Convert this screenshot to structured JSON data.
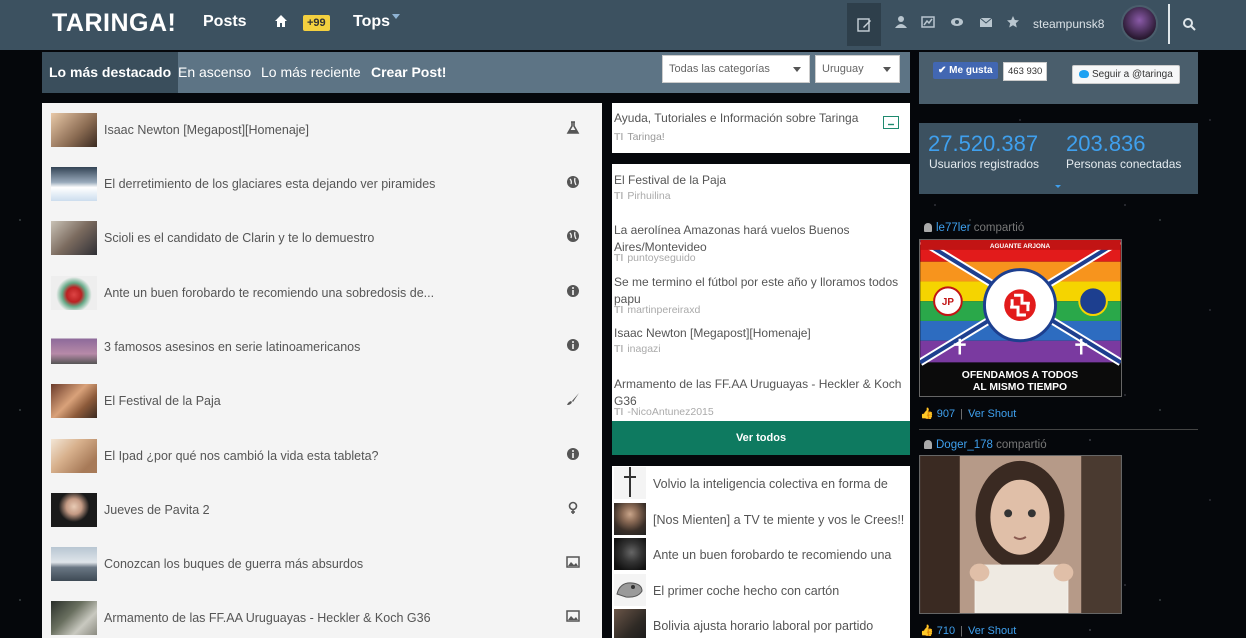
{
  "topbar": {
    "logo": "TARINGA!",
    "posts_label": "Posts",
    "badge": "+99",
    "tops_label": "Tops",
    "username": "steampunsk8"
  },
  "subnav": {
    "items": [
      "Lo más destacado",
      "En ascenso",
      "Lo más reciente",
      "Crear Post!"
    ],
    "category_select": "Todas las categorías",
    "country_select": "Uruguay"
  },
  "posts": [
    {
      "title": "Isaac Newton [Megapost][Homenaje]",
      "icon": "flask-icon"
    },
    {
      "title": "El derretimiento de los glaciares esta dejando ver piramides",
      "icon": "globe-icon"
    },
    {
      "title": "Scioli es el candidato de Clarin y te lo demuestro",
      "icon": "globe-icon"
    },
    {
      "title": "Ante un buen forobardo te recomiendo una sobredosis de...",
      "icon": "info-icon"
    },
    {
      "title": "3 famosos asesinos en serie latinoamericanos",
      "icon": "info-icon"
    },
    {
      "title": "El Festival de la Paja",
      "icon": "brush-icon"
    },
    {
      "title": "El Ipad ¿por qué nos cambió la vida esta tableta?",
      "icon": "info-icon"
    },
    {
      "title": "Jueves de Pavita 2",
      "icon": "female-icon"
    },
    {
      "title": "Conozcan los buques de guerra más absurdos",
      "icon": "image-icon"
    },
    {
      "title": "Armamento de las FF.AA Uruguayas - Heckler & Koch G36",
      "icon": "image-icon"
    }
  ],
  "help": {
    "title": "Ayuda, Tutoriales e Información sobre Taringa",
    "author": "Taringa!"
  },
  "tl_prefix": "TI",
  "middle_list": [
    {
      "title": "El Festival de la Paja",
      "author": "Pirhuilina"
    },
    {
      "title": "La aerolínea Amazonas hará vuelos Buenos Aires/Montevideo",
      "author": "puntoyseguido"
    },
    {
      "title": "Se me termino el fútbol por este año y lloramos todos papu",
      "author": "martinpereiraxd"
    },
    {
      "title": "Isaac Newton [Megapost][Homenaje]",
      "author": "inagazi"
    },
    {
      "title": "Armamento de las FF.AA Uruguayas - Heckler & Koch G36",
      "author": "-NicoAntunez2015"
    }
  ],
  "ver_todos": "Ver todos",
  "middle_list2": [
    "Volvio la inteligencia colectiva en forma de",
    "[Nos Mienten]  a TV te miente y vos le Crees!!",
    "Ante un buen forobardo te recomiendo una",
    "El primer coche hecho con cartón",
    "Bolivia ajusta horario laboral por partido"
  ],
  "social": {
    "fb_like": "Me gusta",
    "fb_count": "463 930",
    "twitter": "Seguir a @taringa"
  },
  "stats": {
    "users_num": "27.520.387",
    "users_label": "Usuarios registrados",
    "online_num": "203.836",
    "online_label": "Personas conectadas"
  },
  "shares": [
    {
      "user": "le77ler",
      "verb": "compartió",
      "likes": "907",
      "action": "Ver Shout",
      "banner_top": "AGUANTE ARJONA",
      "banner_bottom_1": "OFENDAMOS A TODOS",
      "banner_bottom_2": "AL MISMO TIEMPO",
      "left_badge": "JP"
    },
    {
      "user": "Doger_178",
      "verb": "compartió",
      "likes": "710",
      "action": "Ver Shout"
    }
  ]
}
